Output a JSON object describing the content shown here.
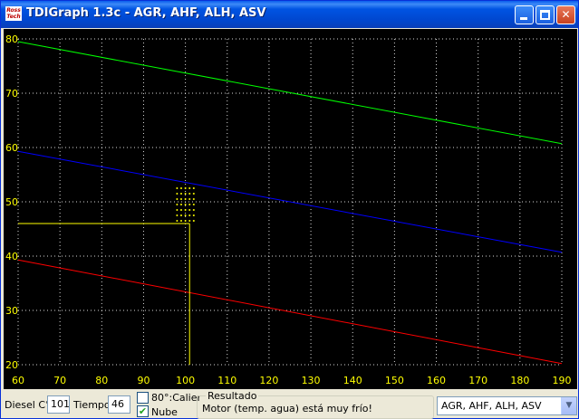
{
  "window": {
    "title": "TDIGraph 1.3c - AGR, AHF, ALH, ASV",
    "logo_top": "Ross",
    "logo_bottom": "Tech"
  },
  "controls": {
    "minimize": "minimize",
    "maximize": "maximize",
    "close": "✕"
  },
  "chart_data": {
    "type": "line",
    "xlim": [
      60,
      190
    ],
    "ylim": [
      20,
      80
    ],
    "x_ticks": [
      60,
      70,
      80,
      90,
      100,
      110,
      120,
      130,
      140,
      150,
      160,
      170,
      180,
      190
    ],
    "y_ticks": [
      20,
      30,
      40,
      50,
      60,
      70,
      80
    ],
    "grid": true,
    "series": [
      {
        "color": "#00ff00",
        "x": [
          60,
          190
        ],
        "y": [
          79.5,
          60.7
        ]
      },
      {
        "color": "#0000ff",
        "x": [
          60,
          190
        ],
        "y": [
          59.3,
          40.7
        ]
      },
      {
        "color": "#ff0000",
        "x": [
          60,
          190
        ],
        "y": [
          39.3,
          20.2
        ]
      }
    ],
    "cursor": {
      "x": 101,
      "y": 46,
      "color": "#ffff00"
    },
    "cloud": {
      "color": "#ffff00",
      "x": [
        98,
        99,
        100,
        101,
        102
      ],
      "y": [
        46.5,
        47.5,
        48.5,
        49.5,
        50.5,
        51.5,
        52.5
      ]
    }
  },
  "status": {
    "diesel_label": "Diesel C°",
    "diesel_value": "101",
    "tiempo_label": "Tiempo",
    "tiempo_value": "46",
    "calier_label": "80°:Calier",
    "calier_checked": false,
    "nube_label": "Nube",
    "nube_checked": true,
    "resultado_title": "Resultado",
    "resultado_text": "Motor (temp. agua) está muy frío!",
    "engine_select": "AGR, AHF, ALH, ASV"
  }
}
